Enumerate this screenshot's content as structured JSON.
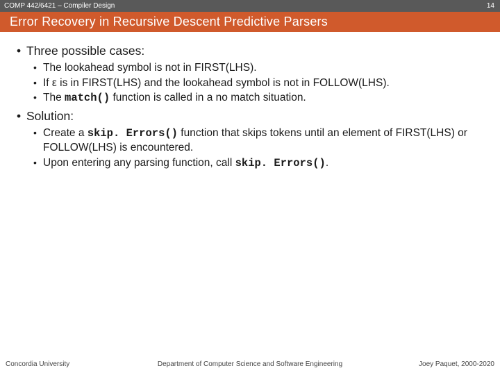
{
  "topbar": {
    "course": "COMP 442/6421 – Compiler Design",
    "page": "14"
  },
  "title": "Error Recovery in Recursive Descent Predictive Parsers",
  "sections": [
    {
      "heading": "Three possible cases:",
      "items": [
        {
          "parts": [
            {
              "t": "The lookahead symbol is not in FIRST(LHS)."
            }
          ]
        },
        {
          "parts": [
            {
              "t": "If "
            },
            {
              "t": "ε",
              "cls": ""
            },
            {
              "t": " is in FIRST(LHS) and the lookahead symbol is not in FOLLOW(LHS)."
            }
          ]
        },
        {
          "parts": [
            {
              "t": "The "
            },
            {
              "t": "match()",
              "cls": "mono"
            },
            {
              "t": " function is called in a no match situation."
            }
          ]
        }
      ]
    },
    {
      "heading": "Solution:",
      "items": [
        {
          "parts": [
            {
              "t": "Create a "
            },
            {
              "t": "skip. Errors()",
              "cls": "mono"
            },
            {
              "t": " function that skips tokens until an element of FIRST(LHS) or FOLLOW(LHS) is encountered."
            }
          ]
        },
        {
          "parts": [
            {
              "t": "Upon entering any parsing function, call "
            },
            {
              "t": "skip. Errors()",
              "cls": "mono"
            },
            {
              "t": "."
            }
          ]
        }
      ]
    }
  ],
  "footer": {
    "left": "Concordia University",
    "mid": "Department of Computer Science and Software Engineering",
    "right": "Joey Paquet, 2000-2020"
  }
}
